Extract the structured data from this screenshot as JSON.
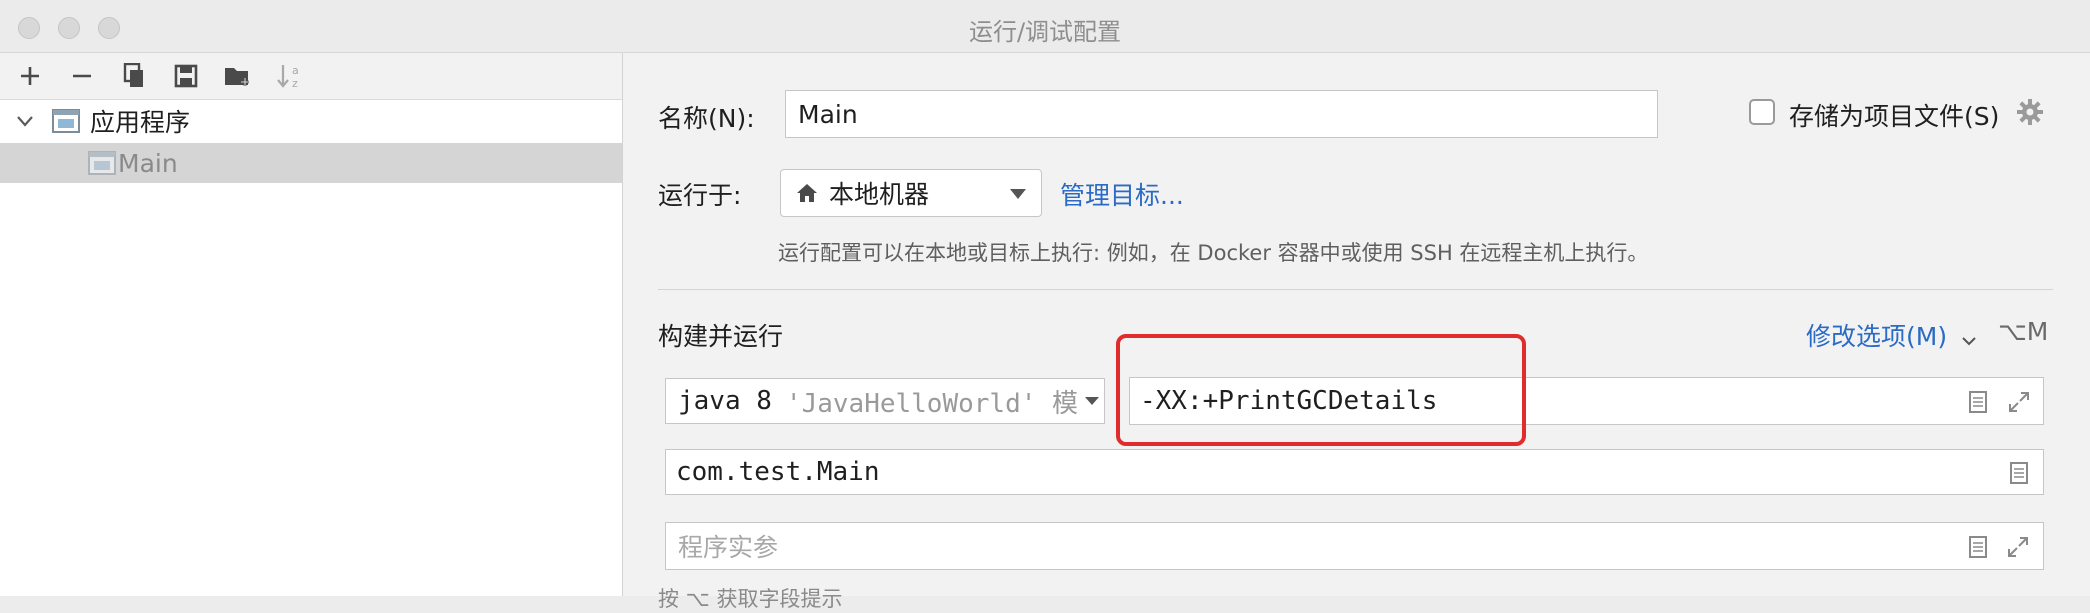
{
  "window": {
    "title": "运行/调试配置"
  },
  "toolbar": {
    "icons": [
      "add-icon",
      "remove-icon",
      "copy-icon",
      "save-icon",
      "new-folder-icon",
      "sort-icon"
    ]
  },
  "tree": {
    "root_label": "应用程序",
    "child_label": "Main"
  },
  "form": {
    "name_label": "名称(N):",
    "name_value": "Main",
    "store_label": "存储为项目文件(S)",
    "run_on_label": "运行于:",
    "run_on_value": "本地机器",
    "manage_targets": "管理目标...",
    "run_on_hint": "运行配置可以在本地或目标上执行: 例如，在 Docker 容器中或使用 SSH 在远程主机上执行。",
    "build_run_title": "构建并运行",
    "modify_options": "修改选项(M)",
    "modify_shortcut": "⌥M",
    "jdk_version": "java 8",
    "jdk_project": "'JavaHelloWorld' 模",
    "vm_options": "-XX:+PrintGCDetails",
    "main_class": "com.test.Main",
    "program_args_placeholder": "程序实参",
    "bottom_hint": "按 ⌥ 获取字段提示"
  },
  "colors": {
    "link": "#2a6bc5",
    "highlight": "#e02c2c",
    "selection": "#d5d5d5"
  }
}
